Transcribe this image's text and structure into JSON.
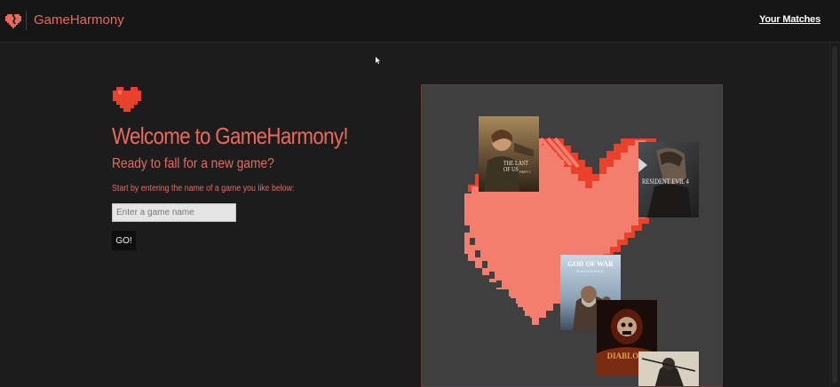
{
  "nav": {
    "brand": "GameHarmony",
    "matches_link": "Your Matches"
  },
  "hero": {
    "title": "Welcome to GameHarmony!",
    "subtitle": "Ready to fall for a new game?",
    "prompt": "Start by entering the name of a game you like below:",
    "input_placeholder": "Enter a game name",
    "input_value": "",
    "go_button": "GO!"
  },
  "covers": {
    "tlou": "THE LAST OF US",
    "tlou_sub": "PART I",
    "re4": "RESIDENT EVIL 4",
    "gow_line1": "GOD OF WAR",
    "gow_line2": "RAGNARÖK",
    "diablo": "DIABLO II"
  },
  "colors": {
    "accent": "#e86a5c",
    "heart_light": "#f47e6e",
    "heart_dark": "#e8412c",
    "background": "#1c1c1c",
    "panel": "#3f3f3f"
  },
  "icons": {
    "brand": "heart-broken-pixel-icon",
    "logo": "pixel-heart-icon"
  }
}
